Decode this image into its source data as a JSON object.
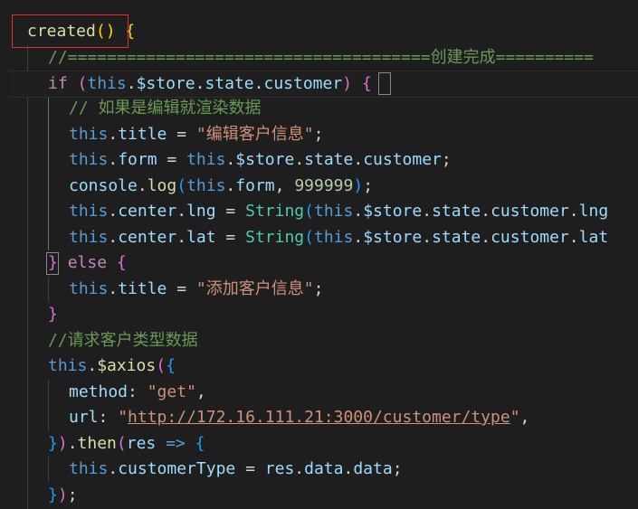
{
  "editor": {
    "language": "javascript",
    "colors": {
      "background": "#1e1e1e",
      "annotation_box": "#e03131"
    },
    "lines": [
      [
        [
          "fn",
          "created"
        ],
        [
          "br1",
          "()"
        ],
        [
          "pun",
          " "
        ],
        [
          "br1",
          "{"
        ]
      ],
      [
        [
          "com",
          "//=====================================创建完成=========="
        ]
      ],
      [
        [
          "kw-ctrl",
          "if"
        ],
        [
          "pun",
          " "
        ],
        [
          "br2",
          "("
        ],
        [
          "kw-this",
          "this"
        ],
        [
          "pun",
          "."
        ],
        [
          "prop",
          "$store"
        ],
        [
          "pun",
          "."
        ],
        [
          "prop",
          "state"
        ],
        [
          "pun",
          "."
        ],
        [
          "prop",
          "customer"
        ],
        [
          "br2",
          ")"
        ],
        [
          "pun",
          " "
        ],
        [
          "br2",
          "{"
        ]
      ],
      [
        [
          "com",
          "// 如果是编辑就渲染数据"
        ]
      ],
      [
        [
          "kw-this",
          "this"
        ],
        [
          "pun",
          "."
        ],
        [
          "prop",
          "title"
        ],
        [
          "pun",
          " = "
        ],
        [
          "str",
          "\"编辑客户信息\""
        ],
        [
          "pun",
          ";"
        ]
      ],
      [
        [
          "kw-this",
          "this"
        ],
        [
          "pun",
          "."
        ],
        [
          "prop",
          "form"
        ],
        [
          "pun",
          " = "
        ],
        [
          "kw-this",
          "this"
        ],
        [
          "pun",
          "."
        ],
        [
          "prop",
          "$store"
        ],
        [
          "pun",
          "."
        ],
        [
          "prop",
          "state"
        ],
        [
          "pun",
          "."
        ],
        [
          "prop",
          "customer"
        ],
        [
          "pun",
          ";"
        ]
      ],
      [
        [
          "prop",
          "console"
        ],
        [
          "pun",
          "."
        ],
        [
          "fn",
          "log"
        ],
        [
          "br3",
          "("
        ],
        [
          "kw-this",
          "this"
        ],
        [
          "pun",
          "."
        ],
        [
          "prop",
          "form"
        ],
        [
          "pun",
          ", "
        ],
        [
          "num",
          "999999"
        ],
        [
          "br3",
          ")"
        ],
        [
          "pun",
          ";"
        ]
      ],
      [
        [
          "kw-this",
          "this"
        ],
        [
          "pun",
          "."
        ],
        [
          "prop",
          "center"
        ],
        [
          "pun",
          "."
        ],
        [
          "prop",
          "lng"
        ],
        [
          "pun",
          " = "
        ],
        [
          "cls",
          "String"
        ],
        [
          "br3",
          "("
        ],
        [
          "kw-this",
          "this"
        ],
        [
          "pun",
          "."
        ],
        [
          "prop",
          "$store"
        ],
        [
          "pun",
          "."
        ],
        [
          "prop",
          "state"
        ],
        [
          "pun",
          "."
        ],
        [
          "prop",
          "customer"
        ],
        [
          "pun",
          "."
        ],
        [
          "prop",
          "lng"
        ]
      ],
      [
        [
          "kw-this",
          "this"
        ],
        [
          "pun",
          "."
        ],
        [
          "prop",
          "center"
        ],
        [
          "pun",
          "."
        ],
        [
          "prop",
          "lat"
        ],
        [
          "pun",
          " = "
        ],
        [
          "cls",
          "String"
        ],
        [
          "br3",
          "("
        ],
        [
          "kw-this",
          "this"
        ],
        [
          "pun",
          "."
        ],
        [
          "prop",
          "$store"
        ],
        [
          "pun",
          "."
        ],
        [
          "prop",
          "state"
        ],
        [
          "pun",
          "."
        ],
        [
          "prop",
          "customer"
        ],
        [
          "pun",
          "."
        ],
        [
          "prop",
          "lat"
        ]
      ],
      [
        [
          "br2",
          "}"
        ],
        [
          "pun",
          " "
        ],
        [
          "kw-ctrl",
          "else"
        ],
        [
          "pun",
          " "
        ],
        [
          "br2",
          "{"
        ]
      ],
      [
        [
          "kw-this",
          "this"
        ],
        [
          "pun",
          "."
        ],
        [
          "prop",
          "title"
        ],
        [
          "pun",
          " = "
        ],
        [
          "str",
          "\"添加客户信息\""
        ],
        [
          "pun",
          ";"
        ]
      ],
      [
        [
          "br2",
          "}"
        ]
      ],
      [
        [
          "com",
          "//请求客户类型数据"
        ]
      ],
      [
        [
          "kw-this",
          "this"
        ],
        [
          "pun",
          "."
        ],
        [
          "fn",
          "$axios"
        ],
        [
          "br2",
          "("
        ],
        [
          "br3",
          "{"
        ]
      ],
      [
        [
          "prop",
          "method"
        ],
        [
          "pun",
          ": "
        ],
        [
          "str",
          "\"get\""
        ],
        [
          "pun",
          ","
        ]
      ],
      [
        [
          "prop",
          "url"
        ],
        [
          "pun",
          ": "
        ],
        [
          "str",
          "\""
        ],
        [
          "str url",
          "http://172.16.111.21:3000/customer/type"
        ],
        [
          "str",
          "\""
        ],
        [
          "pun",
          ","
        ]
      ],
      [
        [
          "br3",
          "}"
        ],
        [
          "br2",
          ")"
        ],
        [
          "pun",
          "."
        ],
        [
          "fn",
          "then"
        ],
        [
          "br2",
          "("
        ],
        [
          "prop",
          "res"
        ],
        [
          "pun",
          " "
        ],
        [
          "kw-this",
          "=>"
        ],
        [
          "pun",
          " "
        ],
        [
          "br3",
          "{"
        ]
      ],
      [
        [
          "kw-this",
          "this"
        ],
        [
          "pun",
          "."
        ],
        [
          "prop",
          "customerType"
        ],
        [
          "pun",
          " = "
        ],
        [
          "prop",
          "res"
        ],
        [
          "pun",
          "."
        ],
        [
          "prop",
          "data"
        ],
        [
          "pun",
          "."
        ],
        [
          "prop",
          "data"
        ],
        [
          "pun",
          ";"
        ]
      ],
      [
        [
          "br3",
          "}"
        ],
        [
          "br2",
          ")"
        ],
        [
          "pun",
          ";"
        ]
      ]
    ]
  }
}
